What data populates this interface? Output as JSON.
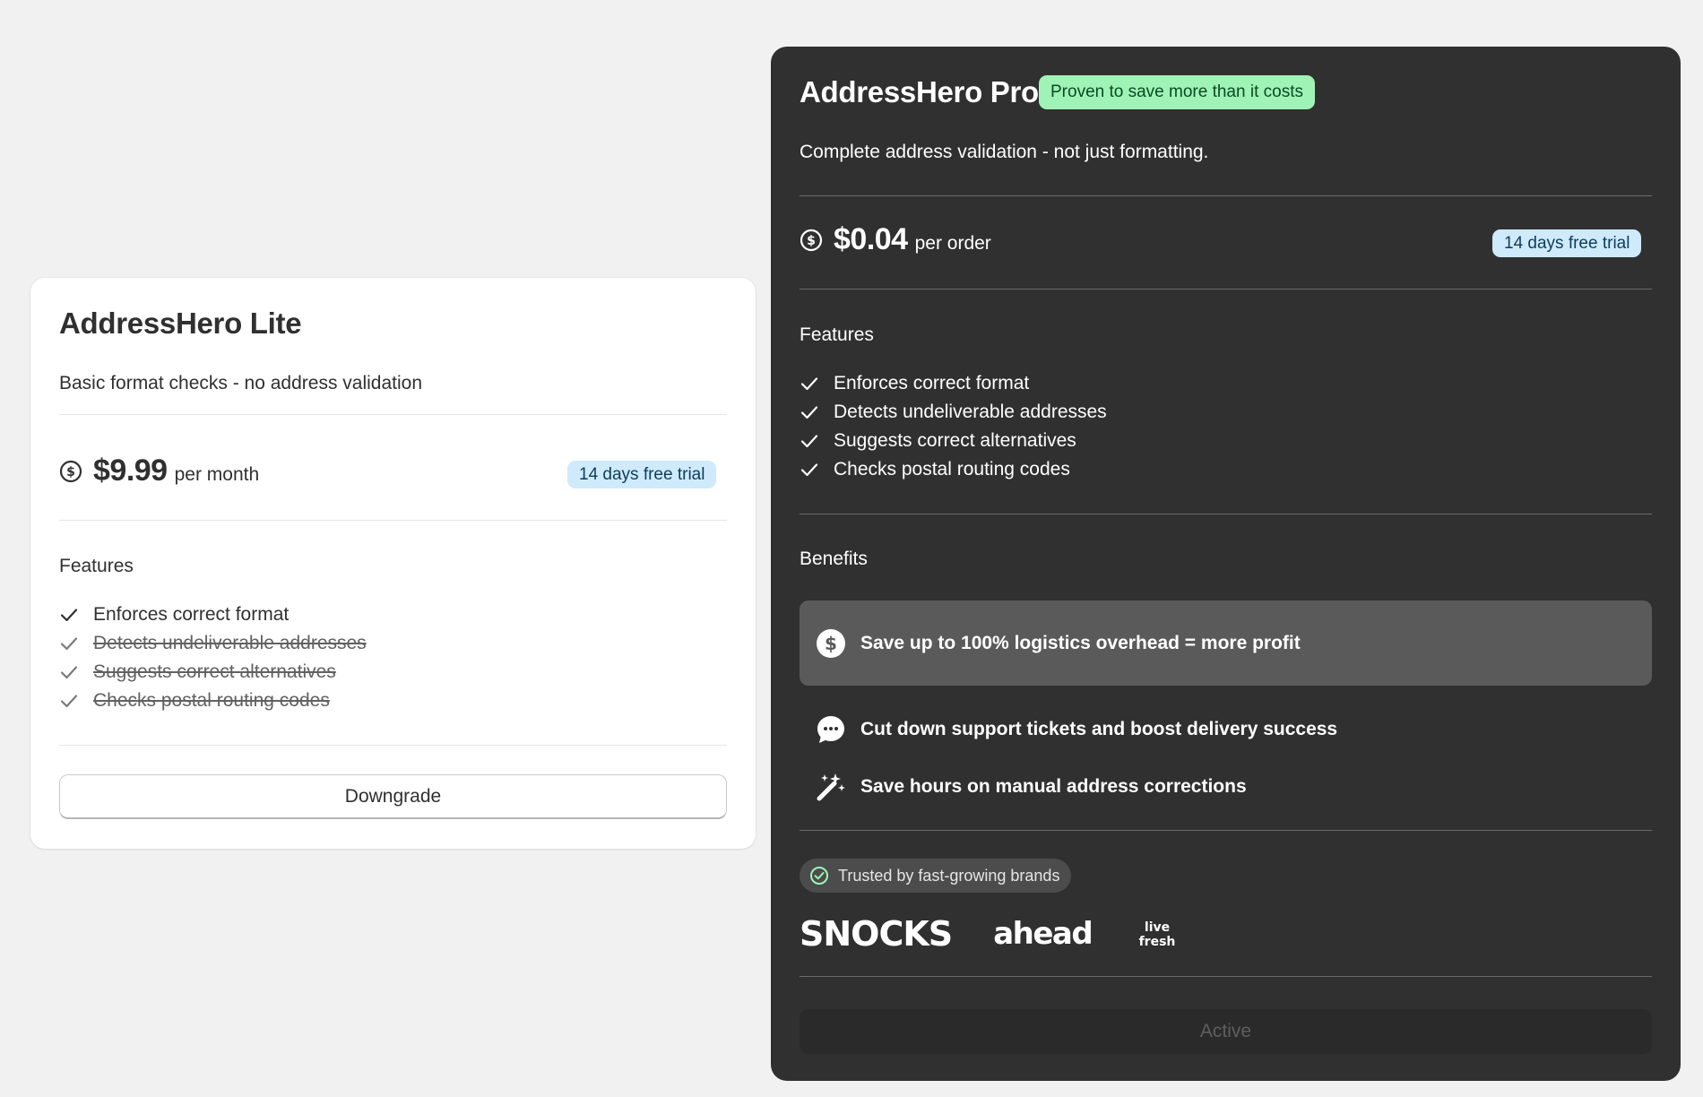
{
  "lite": {
    "title": "AddressHero Lite",
    "subtitle": "Basic format checks - no address validation",
    "price": "$9.99",
    "price_unit": "per month",
    "trial_badge": "14 days free trial",
    "features_label": "Features",
    "features": [
      {
        "text": "Enforces correct format",
        "included": true
      },
      {
        "text": "Detects undeliverable addresses",
        "included": false
      },
      {
        "text": "Suggests correct alternatives",
        "included": false
      },
      {
        "text": "Checks postal routing codes",
        "included": false
      }
    ],
    "button_label": "Downgrade"
  },
  "pro": {
    "title": "AddressHero Pro",
    "promo_badge": "Proven to save more than it costs",
    "subtitle": "Complete address validation - not just formatting.",
    "price": "$0.04",
    "price_unit": "per order",
    "trial_badge": "14 days free trial",
    "features_label": "Features",
    "features": [
      {
        "text": "Enforces correct format",
        "included": true
      },
      {
        "text": "Detects undeliverable addresses",
        "included": true
      },
      {
        "text": "Suggests correct alternatives",
        "included": true
      },
      {
        "text": "Checks postal routing codes",
        "included": true
      }
    ],
    "benefits_label": "Benefits",
    "benefits": [
      {
        "text": "Save up to 100% logistics overhead = more profit",
        "icon": "dollar-circle-icon"
      },
      {
        "text": "Cut down support tickets and boost delivery success",
        "icon": "chat-bubble-icon"
      },
      {
        "text": "Save hours on manual address corrections",
        "icon": "magic-wand-icon"
      }
    ],
    "trusted_label": "Trusted by fast-growing brands",
    "brands": [
      "SNOCKS",
      "ahead",
      "live fresh"
    ],
    "button_label": "Active"
  },
  "colors": {
    "page_bg": "#f1f1f1",
    "pro_card_bg": "#303030",
    "trial_badge_bg": "#cfeafb",
    "promo_badge_bg": "#9ff3b6",
    "highlight_benefit_bg": "#5a5a5a"
  }
}
